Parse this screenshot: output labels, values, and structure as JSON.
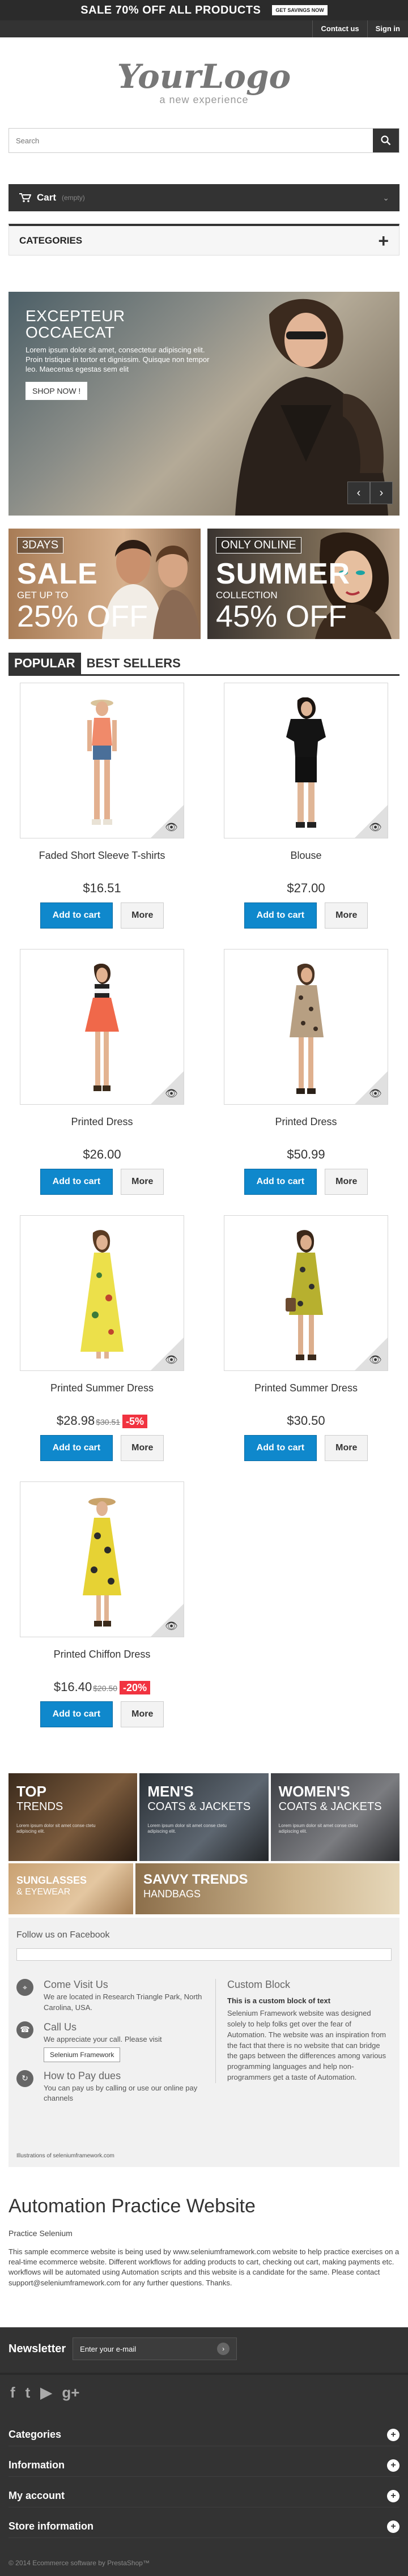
{
  "top_banner": {
    "sale_text": "SALE 70% OFF ALL PRODUCTS",
    "cta": "GET SAVINGS NOW"
  },
  "nav": {
    "contact": "Contact us",
    "sign_in": "Sign in"
  },
  "logo": {
    "main": "YourLogo",
    "sub": "a new experience"
  },
  "search": {
    "placeholder": "Search"
  },
  "cart": {
    "label": "Cart",
    "status": "(empty)"
  },
  "categories": {
    "label": "CATEGORIES",
    "toggle": "+"
  },
  "slider": {
    "title": "EXCEPTEUR OCCAECAT",
    "text": "Lorem ipsum dolor sit amet, consectetur adipiscing elit. Proin tristique in tortor et dignissim. Quisque non tempor leo. Maecenas egestas sem elit",
    "button": "SHOP NOW !"
  },
  "promos": [
    {
      "tag": "3DAYS",
      "big": "SALE",
      "small": "GET UP TO",
      "pct": "25% OFF"
    },
    {
      "tag": "ONLY ONLINE",
      "big": "SUMMER",
      "small": "COLLECTION",
      "pct": "45% OFF"
    }
  ],
  "tabs": {
    "popular": "POPULAR",
    "best": "BEST SELLERS"
  },
  "buttons": {
    "add": "Add to cart",
    "more": "More"
  },
  "products": [
    {
      "name": "Faded Short Sleeve T-shirts",
      "price": "$16.51",
      "old": "",
      "disc": ""
    },
    {
      "name": "Blouse",
      "price": "$27.00",
      "old": "",
      "disc": ""
    },
    {
      "name": "Printed Dress",
      "price": "$26.00",
      "old": "",
      "disc": ""
    },
    {
      "name": "Printed Dress",
      "price": "$50.99",
      "old": "",
      "disc": ""
    },
    {
      "name": "Printed Summer Dress",
      "price": "$28.98",
      "old": "$30.51",
      "disc": "-5%"
    },
    {
      "name": "Printed Summer Dress",
      "price": "$30.50",
      "old": "",
      "disc": ""
    },
    {
      "name": "Printed Chiffon Dress",
      "price": "$16.40",
      "old": "$20.50",
      "disc": "-20%"
    }
  ],
  "htmlblock": [
    {
      "t1": "TOP",
      "t2": "TRENDS",
      "lorem": "Lorem ipsum dolor sit amet conse ctetu adipiscing elit."
    },
    {
      "t1": "MEN'S",
      "t2": "COATS & JACKETS",
      "lorem": "Lorem ipsum dolor sit amet conse ctetu adipiscing elit."
    },
    {
      "t1": "WOMEN'S",
      "t2": "COATS & JACKETS",
      "lorem": "Lorem ipsum dolor sit amet conse ctetu adipiscing elit."
    },
    {
      "t1": "SUNGLASSES",
      "t2": "& EYEWEAR",
      "lorem": ""
    },
    {
      "t1": "SAVVY TRENDS",
      "t2": "HANDBAGS",
      "lorem": ""
    }
  ],
  "facebook": {
    "heading": "Follow us on Facebook"
  },
  "contact": {
    "visit_title": "Come Visit Us",
    "visit_text": "We are located in Research Triangle Park, North Carolina, USA.",
    "call_title": "Call Us",
    "call_text": "We appreciate your call. Please visit",
    "call_button": "Selenium Framework",
    "pay_title": "How to Pay dues",
    "pay_text": "You can pay us by calling or use our online pay channels"
  },
  "custom": {
    "title": "Custom Block",
    "bold": "This is a custom block of text",
    "text": "Selenium Framework website was designed solely to help folks get over the fear of Automation. The website was an inspiration from the fact that there is no website that can bridge the gaps between the differences among various programming languages and help non-programmers get a taste of Automation."
  },
  "cms_foot": "Illustrations of seleniumframework.com",
  "about": {
    "title": "Automation Practice Website",
    "p1": "Practice Selenium",
    "p2": "This sample ecommerce website is being used by www.seleniumframework.com website to help practice exercises on a real-time ecommerce website. Different workflows for adding products to cart, checking out cart, making payments etc. workflows will be automated using Automation scripts and this website is a candidate for the same. Please contact support@seleniumframework.com for any further questions. Thanks."
  },
  "footer": {
    "newsletter": "Newsletter",
    "email_placeholder": "Enter your e-mail",
    "sections": [
      "Categories",
      "Information",
      "My account",
      "Store information"
    ],
    "copyright": "© 2014 Ecommerce software by PrestaShop™"
  }
}
